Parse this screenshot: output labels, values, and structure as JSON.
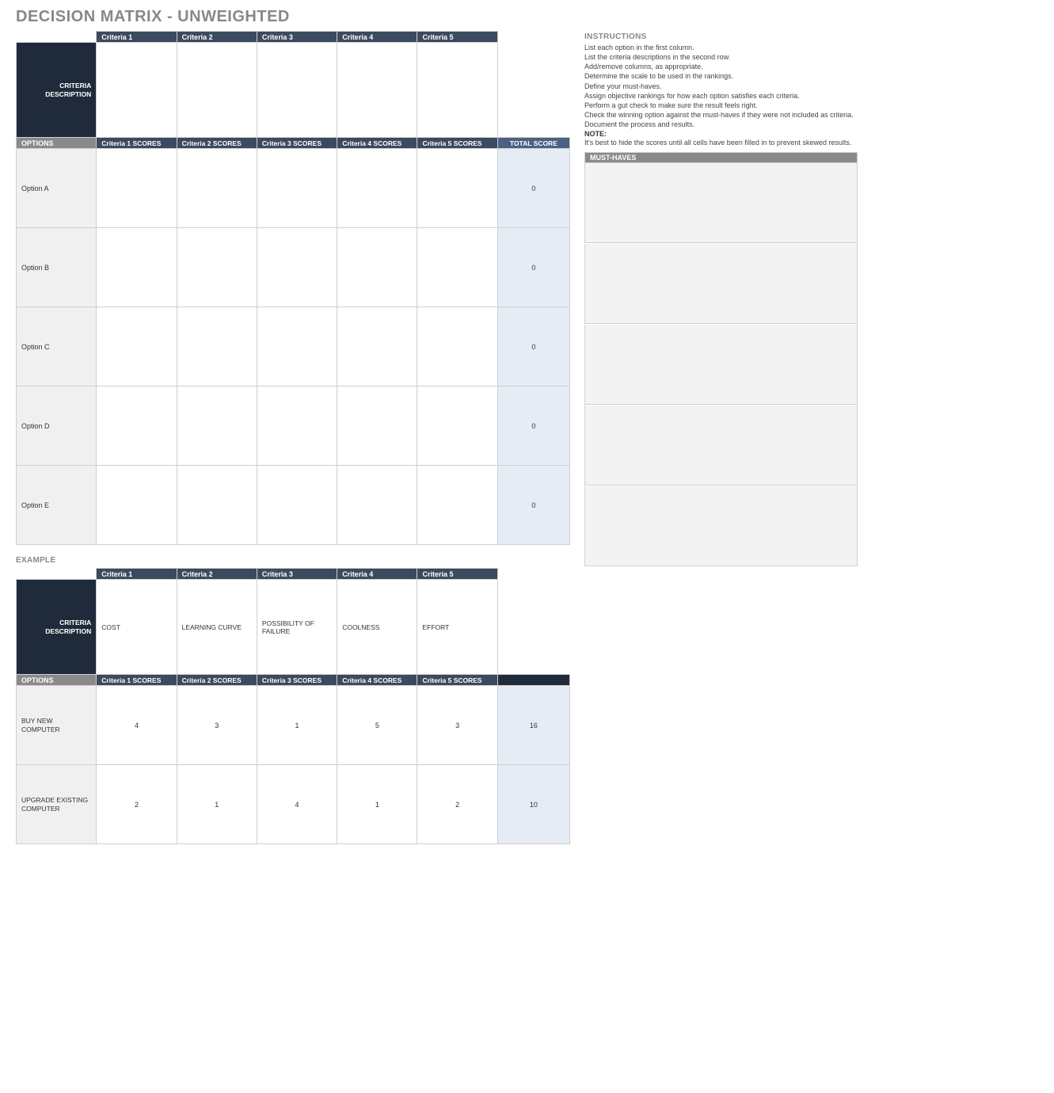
{
  "title": "DECISION MATRIX - UNWEIGHTED",
  "main": {
    "criteria_header": [
      "Criteria 1",
      "Criteria 2",
      "Criteria 3",
      "Criteria 4",
      "Criteria 5"
    ],
    "criteria_desc_label": "CRITERIA DESCRIPTION",
    "criteria_desc": [
      "",
      "",
      "",
      "",
      ""
    ],
    "options_label": "OPTIONS",
    "scores_header": [
      "Criteria 1 SCORES",
      "Criteria 2 SCORES",
      "Criteria 3 SCORES",
      "Criteria 4 SCORES",
      "Criteria 5 SCORES"
    ],
    "total_label": "TOTAL SCORE",
    "rows": [
      {
        "name": "Option A",
        "scores": [
          "",
          "",
          "",
          "",
          ""
        ],
        "total": "0"
      },
      {
        "name": "Option B",
        "scores": [
          "",
          "",
          "",
          "",
          ""
        ],
        "total": "0"
      },
      {
        "name": "Option C",
        "scores": [
          "",
          "",
          "",
          "",
          ""
        ],
        "total": "0"
      },
      {
        "name": "Option D",
        "scores": [
          "",
          "",
          "",
          "",
          ""
        ],
        "total": "0"
      },
      {
        "name": "Option E",
        "scores": [
          "",
          "",
          "",
          "",
          ""
        ],
        "total": "0"
      }
    ]
  },
  "instructions": {
    "heading": "INSTRUCTIONS",
    "lines": [
      "List each option in the first column.",
      "List the criteria descriptions in the second row.",
      "Add/remove columns, as appropriate.",
      "Determine the scale to be used in the rankings.",
      "Define your must-haves.",
      "Assign objective rankings for how each option satisfies each criteria.",
      "Perform a gut check to make sure the result feels right.",
      "Check the winning option against the must-haves if they were not included as criteria.",
      "Document the process and results."
    ],
    "note_label": "NOTE:",
    "note_text": "It's best to hide the scores until all cells have been filled in to prevent skewed results."
  },
  "musthaves": {
    "heading": "MUST-HAVES",
    "boxes": [
      "",
      "",
      "",
      "",
      ""
    ]
  },
  "example": {
    "label": "EXAMPLE",
    "criteria_header": [
      "Criteria 1",
      "Criteria 2",
      "Criteria 3",
      "Criteria 4",
      "Criteria 5"
    ],
    "criteria_desc_label": "CRITERIA DESCRIPTION",
    "criteria_desc": [
      "COST",
      "LEARNING CURVE",
      "POSSIBILITY OF FAILURE",
      "COOLNESS",
      "EFFORT"
    ],
    "options_label": "OPTIONS",
    "scores_header": [
      "Criteria 1 SCORES",
      "Criteria 2 SCORES",
      "Criteria 3 SCORES",
      "Criteria 4 SCORES",
      "Criteria 5 SCORES"
    ],
    "rows": [
      {
        "name": "BUY NEW COMPUTER",
        "scores": [
          "4",
          "3",
          "1",
          "5",
          "3"
        ],
        "total": "16"
      },
      {
        "name": "UPGRADE EXISTING COMPUTER",
        "scores": [
          "2",
          "1",
          "4",
          "1",
          "2"
        ],
        "total": "10"
      }
    ]
  }
}
